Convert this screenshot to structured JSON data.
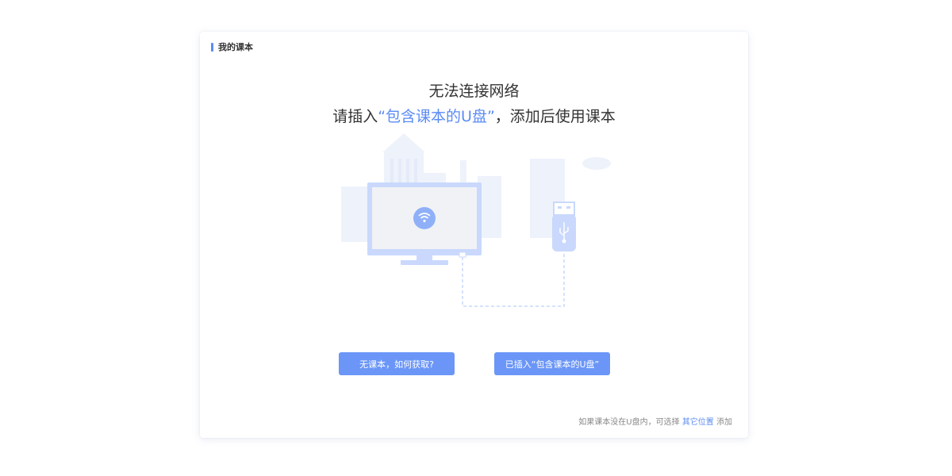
{
  "panel": {
    "title": "我的课本"
  },
  "message": {
    "headline": "无法连接网络",
    "sub_prefix": "请插入",
    "sub_highlight": "“包含课本的U盘”",
    "sub_suffix": "，添加后使用课本"
  },
  "illustration": {
    "icons": [
      "monitor-icon",
      "wifi-icon",
      "usb-drive-icon",
      "usb-symbol-icon",
      "cable-dashed"
    ]
  },
  "actions": {
    "no_book_label": "无课本，如何获取?",
    "inserted_label": "已插入“包含课本的U盘”"
  },
  "footer": {
    "note_prefix": "如果课本没在U盘内，可选择",
    "link_label": "其它位置",
    "note_suffix": "添加"
  },
  "colors": {
    "accent": "#5b8bf5",
    "button": "#6b96f7",
    "illustration_light": "#dbe6fd"
  }
}
